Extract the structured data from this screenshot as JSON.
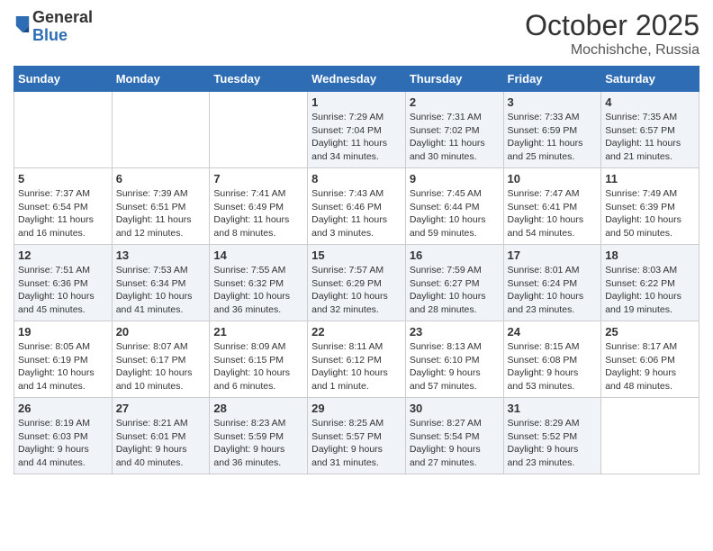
{
  "header": {
    "logo_general": "General",
    "logo_blue": "Blue",
    "month": "October 2025",
    "location": "Mochishche, Russia"
  },
  "weekdays": [
    "Sunday",
    "Monday",
    "Tuesday",
    "Wednesday",
    "Thursday",
    "Friday",
    "Saturday"
  ],
  "weeks": [
    [
      {
        "day": "",
        "text": ""
      },
      {
        "day": "",
        "text": ""
      },
      {
        "day": "",
        "text": ""
      },
      {
        "day": "1",
        "text": "Sunrise: 7:29 AM\nSunset: 7:04 PM\nDaylight: 11 hours\nand 34 minutes."
      },
      {
        "day": "2",
        "text": "Sunrise: 7:31 AM\nSunset: 7:02 PM\nDaylight: 11 hours\nand 30 minutes."
      },
      {
        "day": "3",
        "text": "Sunrise: 7:33 AM\nSunset: 6:59 PM\nDaylight: 11 hours\nand 25 minutes."
      },
      {
        "day": "4",
        "text": "Sunrise: 7:35 AM\nSunset: 6:57 PM\nDaylight: 11 hours\nand 21 minutes."
      }
    ],
    [
      {
        "day": "5",
        "text": "Sunrise: 7:37 AM\nSunset: 6:54 PM\nDaylight: 11 hours\nand 16 minutes."
      },
      {
        "day": "6",
        "text": "Sunrise: 7:39 AM\nSunset: 6:51 PM\nDaylight: 11 hours\nand 12 minutes."
      },
      {
        "day": "7",
        "text": "Sunrise: 7:41 AM\nSunset: 6:49 PM\nDaylight: 11 hours\nand 8 minutes."
      },
      {
        "day": "8",
        "text": "Sunrise: 7:43 AM\nSunset: 6:46 PM\nDaylight: 11 hours\nand 3 minutes."
      },
      {
        "day": "9",
        "text": "Sunrise: 7:45 AM\nSunset: 6:44 PM\nDaylight: 10 hours\nand 59 minutes."
      },
      {
        "day": "10",
        "text": "Sunrise: 7:47 AM\nSunset: 6:41 PM\nDaylight: 10 hours\nand 54 minutes."
      },
      {
        "day": "11",
        "text": "Sunrise: 7:49 AM\nSunset: 6:39 PM\nDaylight: 10 hours\nand 50 minutes."
      }
    ],
    [
      {
        "day": "12",
        "text": "Sunrise: 7:51 AM\nSunset: 6:36 PM\nDaylight: 10 hours\nand 45 minutes."
      },
      {
        "day": "13",
        "text": "Sunrise: 7:53 AM\nSunset: 6:34 PM\nDaylight: 10 hours\nand 41 minutes."
      },
      {
        "day": "14",
        "text": "Sunrise: 7:55 AM\nSunset: 6:32 PM\nDaylight: 10 hours\nand 36 minutes."
      },
      {
        "day": "15",
        "text": "Sunrise: 7:57 AM\nSunset: 6:29 PM\nDaylight: 10 hours\nand 32 minutes."
      },
      {
        "day": "16",
        "text": "Sunrise: 7:59 AM\nSunset: 6:27 PM\nDaylight: 10 hours\nand 28 minutes."
      },
      {
        "day": "17",
        "text": "Sunrise: 8:01 AM\nSunset: 6:24 PM\nDaylight: 10 hours\nand 23 minutes."
      },
      {
        "day": "18",
        "text": "Sunrise: 8:03 AM\nSunset: 6:22 PM\nDaylight: 10 hours\nand 19 minutes."
      }
    ],
    [
      {
        "day": "19",
        "text": "Sunrise: 8:05 AM\nSunset: 6:19 PM\nDaylight: 10 hours\nand 14 minutes."
      },
      {
        "day": "20",
        "text": "Sunrise: 8:07 AM\nSunset: 6:17 PM\nDaylight: 10 hours\nand 10 minutes."
      },
      {
        "day": "21",
        "text": "Sunrise: 8:09 AM\nSunset: 6:15 PM\nDaylight: 10 hours\nand 6 minutes."
      },
      {
        "day": "22",
        "text": "Sunrise: 8:11 AM\nSunset: 6:12 PM\nDaylight: 10 hours\nand 1 minute."
      },
      {
        "day": "23",
        "text": "Sunrise: 8:13 AM\nSunset: 6:10 PM\nDaylight: 9 hours\nand 57 minutes."
      },
      {
        "day": "24",
        "text": "Sunrise: 8:15 AM\nSunset: 6:08 PM\nDaylight: 9 hours\nand 53 minutes."
      },
      {
        "day": "25",
        "text": "Sunrise: 8:17 AM\nSunset: 6:06 PM\nDaylight: 9 hours\nand 48 minutes."
      }
    ],
    [
      {
        "day": "26",
        "text": "Sunrise: 8:19 AM\nSunset: 6:03 PM\nDaylight: 9 hours\nand 44 minutes."
      },
      {
        "day": "27",
        "text": "Sunrise: 8:21 AM\nSunset: 6:01 PM\nDaylight: 9 hours\nand 40 minutes."
      },
      {
        "day": "28",
        "text": "Sunrise: 8:23 AM\nSunset: 5:59 PM\nDaylight: 9 hours\nand 36 minutes."
      },
      {
        "day": "29",
        "text": "Sunrise: 8:25 AM\nSunset: 5:57 PM\nDaylight: 9 hours\nand 31 minutes."
      },
      {
        "day": "30",
        "text": "Sunrise: 8:27 AM\nSunset: 5:54 PM\nDaylight: 9 hours\nand 27 minutes."
      },
      {
        "day": "31",
        "text": "Sunrise: 8:29 AM\nSunset: 5:52 PM\nDaylight: 9 hours\nand 23 minutes."
      },
      {
        "day": "",
        "text": ""
      }
    ]
  ]
}
